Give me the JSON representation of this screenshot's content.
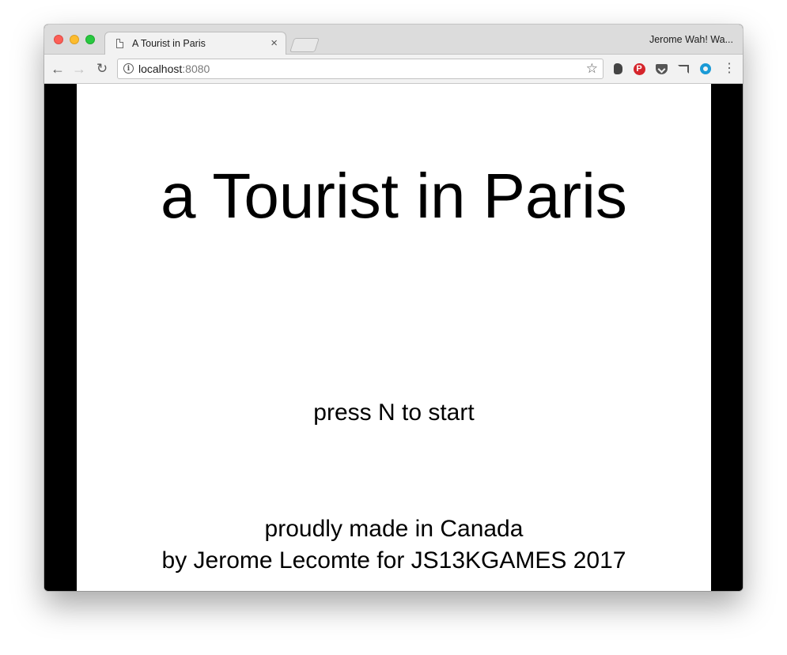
{
  "browser": {
    "tab": {
      "title": "A Tourist in Paris",
      "close_glyph": "×"
    },
    "profile_name": "Jerome Wah! Wa...",
    "nav": {
      "back_glyph": "←",
      "forward_glyph": "→",
      "reload_glyph": "↻"
    },
    "address_bar": {
      "host": "localhost",
      "port": ":8080",
      "info_glyph": "i"
    },
    "bookmark_glyph": "☆",
    "extensions": [
      "evernote-icon",
      "pinterest-icon",
      "pocket-icon",
      "cast-icon",
      "circle-ring-icon"
    ],
    "pinterest_glyph": "P",
    "menu_glyph": "⋮"
  },
  "game": {
    "title": "a Tourist in Paris",
    "prompt": "press N to start",
    "credit_line1": "proudly made in Canada",
    "credit_line2": "by Jerome Lecomte for JS13KGAMES 2017"
  },
  "colors": {
    "close": "#fc5f57",
    "minimize": "#fdbc2e",
    "maximize": "#28c840",
    "letterbox": "#000000",
    "canvas": "#ffffff",
    "pinterest": "#d5252b",
    "ring": "#1a9ad6"
  }
}
